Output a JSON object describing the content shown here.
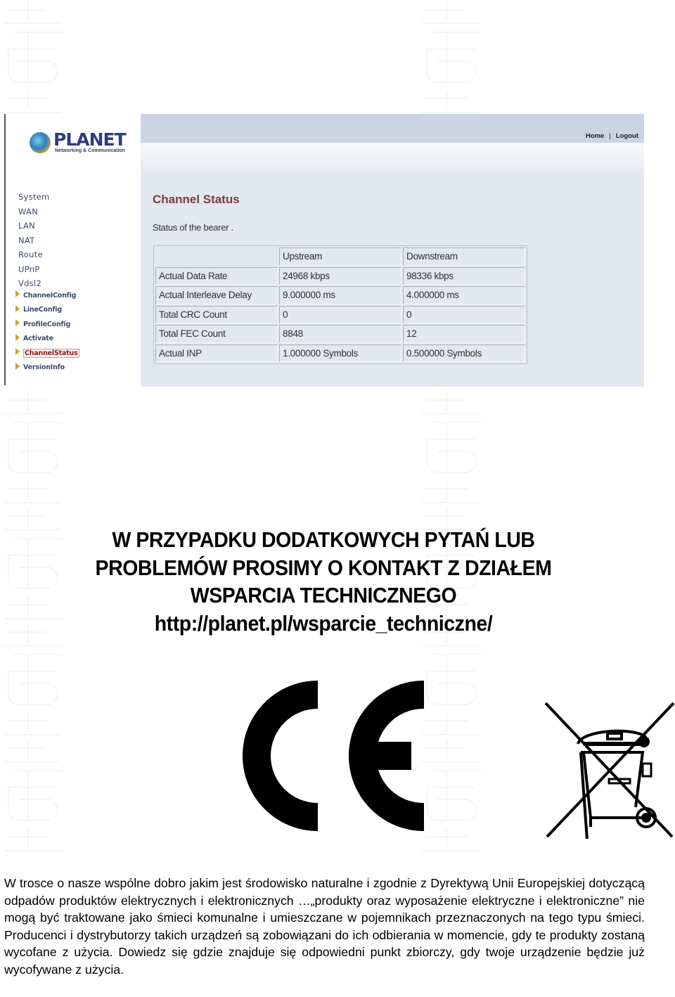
{
  "screenshot": {
    "brand": {
      "name": "PLANET",
      "tagline": "Networking & Communication"
    },
    "sidebar": {
      "items": [
        {
          "label": "System"
        },
        {
          "label": "WAN"
        },
        {
          "label": "LAN"
        },
        {
          "label": "NAT"
        },
        {
          "label": "Route"
        },
        {
          "label": "UPnP"
        },
        {
          "label": "Vdsl2"
        }
      ],
      "subitems": [
        {
          "label": "ChannelConfig",
          "active": false
        },
        {
          "label": "LineConfig",
          "active": false
        },
        {
          "label": "ProfileConfig",
          "active": false
        },
        {
          "label": "Activate",
          "active": false
        },
        {
          "label": "ChannelStatus",
          "active": true
        },
        {
          "label": "VersionInfo",
          "active": false
        }
      ]
    },
    "topbar": {
      "home_label": "Home",
      "separator": "|",
      "logout_label": "Logout"
    },
    "page": {
      "title": "Channel Status",
      "description": "Status of the bearer ."
    },
    "table": {
      "headers": [
        "",
        "Upstream",
        "Downstream"
      ],
      "rows": [
        [
          "Actual Data Rate",
          "24968 kbps",
          "98336 kbps"
        ],
        [
          "Actual Interleave Delay",
          "9.000000 ms",
          "4.000000 ms"
        ],
        [
          "Total CRC Count",
          "0",
          "0"
        ],
        [
          "Total FEC Count",
          "8848",
          "12"
        ],
        [
          "Actual INP",
          "1.000000 Symbols",
          "0.500000 Symbols"
        ]
      ]
    }
  },
  "notice": {
    "lines": [
      "W PRZYPADKU DODATKOWYCH PYTAŃ LUB",
      "PROBLEMÓW PROSIMY O KONTAKT Z DZIAŁEM",
      "WSPARCIA TECHNICZNEGO",
      "http://planet.pl/wsparcie_techniczne/"
    ]
  },
  "icons": {
    "ce_mark": "ce-mark-icon",
    "weee": "crossed-out-wheelie-bin-icon"
  },
  "disclaimer": "W trosce o nasze wspólne dobro jakim jest środowisko naturalne i zgodnie z Dyrektywą Unii Europejskiej dotyczącą odpadów produktów elektrycznych i elektronicznych …„produkty oraz wyposażenie elektryczne i elektroniczne” nie mogą być traktowane jako śmieci komunalne i umieszczane w pojemnikach przeznaczonych na tego typu śmieci. Producenci i dystrybutorzy takich urządzeń są zobowiązani do ich odbierania w momencie, gdy te produkty zostaną wycofane z użycia. Dowiedz się gdzie znajduje się odpowiedni punkt zbiorczy, gdy twoje urządzenie będzie już wycofywane z użycia."
}
